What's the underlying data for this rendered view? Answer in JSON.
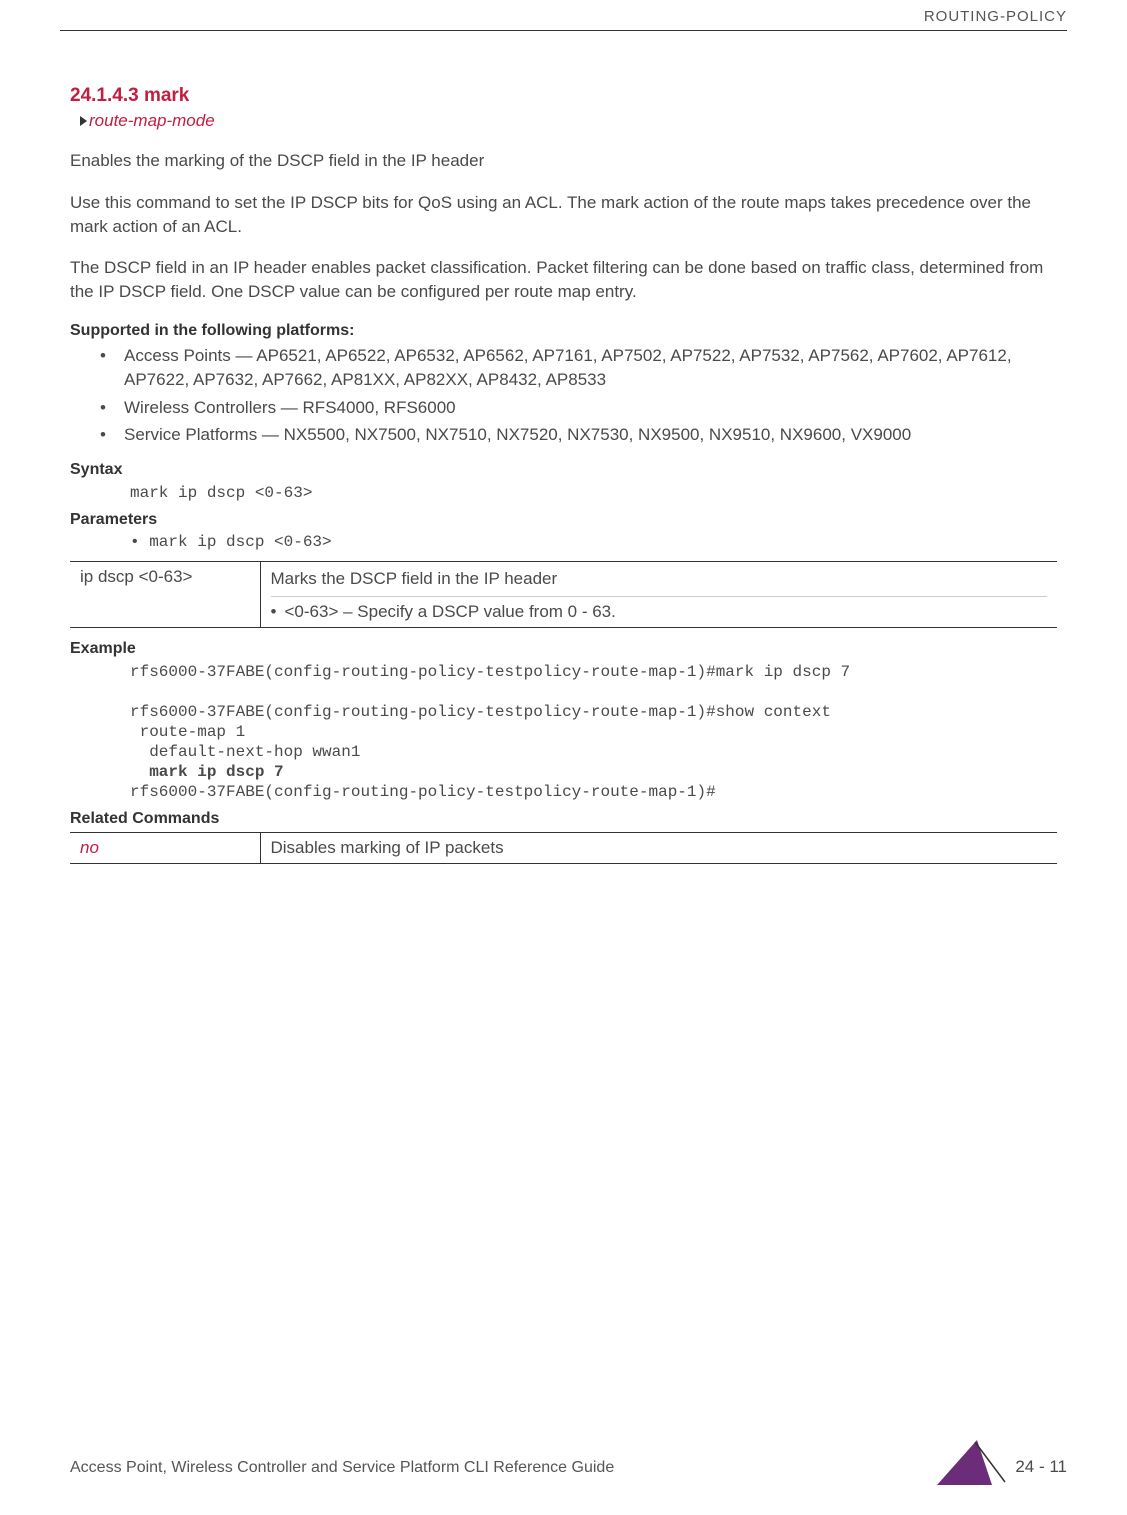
{
  "header": {
    "running_head": "ROUTING-POLICY"
  },
  "section": {
    "number_title": "24.1.4.3 mark",
    "breadcrumb": "route-map-mode",
    "para1": "Enables the marking of the DSCP field in the IP header",
    "para2": "Use this command to set the IP DSCP bits for QoS using an ACL. The mark action of the route maps takes precedence over the mark action of an ACL.",
    "para3": "The DSCP field in an IP header enables packet classification. Packet filtering can be done based on traffic class, determined from the IP DSCP field. One DSCP value can be configured per route map entry."
  },
  "supported": {
    "heading": "Supported in the following platforms:",
    "items": [
      "Access Points — AP6521, AP6522, AP6532, AP6562, AP7161, AP7502, AP7522, AP7532, AP7562, AP7602, AP7612, AP7622, AP7632, AP7662, AP81XX, AP82XX, AP8432, AP8533",
      "Wireless Controllers — RFS4000, RFS6000",
      "Service Platforms — NX5500, NX7500, NX7510, NX7520, NX7530, NX9500, NX9510, NX9600, VX9000"
    ]
  },
  "syntax": {
    "heading": "Syntax",
    "code": "mark ip dscp <0-63>"
  },
  "parameters": {
    "heading": "Parameters",
    "bullet": "• mark ip dscp <0-63>",
    "table": {
      "param": "ip dscp <0-63>",
      "desc_line1": "Marks the DSCP field in the IP header",
      "desc_bullet": "<0-63> – Specify a DSCP value from 0 - 63."
    }
  },
  "example": {
    "heading": "Example",
    "line1": "rfs6000-37FABE(config-routing-policy-testpolicy-route-map-1)#mark ip dscp 7",
    "line2": "rfs6000-37FABE(config-routing-policy-testpolicy-route-map-1)#show context",
    "line3": " route-map 1",
    "line4": "  default-next-hop wwan1",
    "line5_bold": "  mark ip dscp 7",
    "line6": "rfs6000-37FABE(config-routing-policy-testpolicy-route-map-1)#"
  },
  "related": {
    "heading": "Related Commands",
    "cmd": "no",
    "desc": "Disables marking of IP packets"
  },
  "footer": {
    "doc_title": "Access Point, Wireless Controller and Service Platform CLI Reference Guide",
    "page": "24 - 11"
  }
}
